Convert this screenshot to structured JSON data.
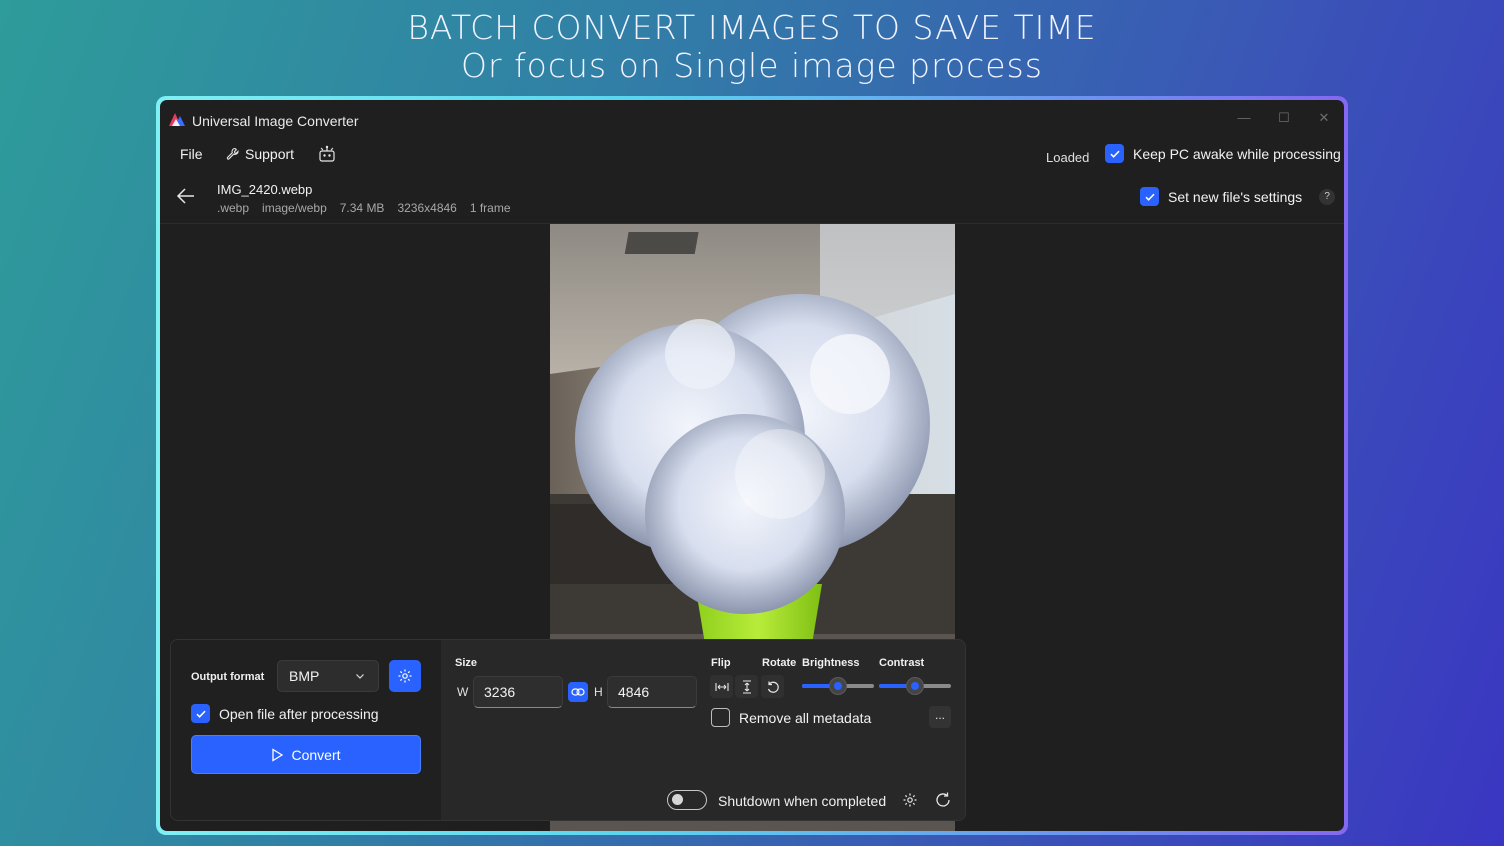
{
  "banner": {
    "line1": "BATCH CONVERT IMAGES TO SAVE TIME",
    "line2": "Or focus on Single image process"
  },
  "window": {
    "title": "Universal Image Converter",
    "controls": [
      "minimize-icon",
      "maximize-icon",
      "close-icon"
    ]
  },
  "menu": {
    "file": "File",
    "support": "Support",
    "status": "Loaded",
    "keep_awake": {
      "label": "Keep PC awake while processing",
      "checked": true
    }
  },
  "file": {
    "name": "IMG_2420.webp",
    "ext": ".webp",
    "mime": "image/webp",
    "size": "7.34 MB",
    "dimensions": "3236x4846",
    "frames": "1 frame",
    "set_new_settings": {
      "label": "Set new file's settings",
      "checked": true
    },
    "help": "?"
  },
  "panel": {
    "output_format_label": "Output format",
    "output_format": "BMP",
    "open_after": {
      "label": "Open file after processing",
      "checked": true
    },
    "convert_label": "Convert",
    "size_label": "Size",
    "w_label": "W",
    "h_label": "H",
    "width": "3236",
    "height": "4846",
    "flip_label": "Flip",
    "rotate_label": "Rotate",
    "brightness_label": "Brightness",
    "contrast_label": "Contrast",
    "brightness_value": 0.5,
    "contrast_value": 0.5,
    "remove_metadata": {
      "label": "Remove all metadata",
      "checked": false
    },
    "more_label": "...",
    "shutdown": {
      "label": "Shutdown when completed",
      "on": false
    }
  },
  "colors": {
    "accent": "#2962ff",
    "window_bg": "#1f1f1f",
    "panel_bg": "#262626"
  }
}
